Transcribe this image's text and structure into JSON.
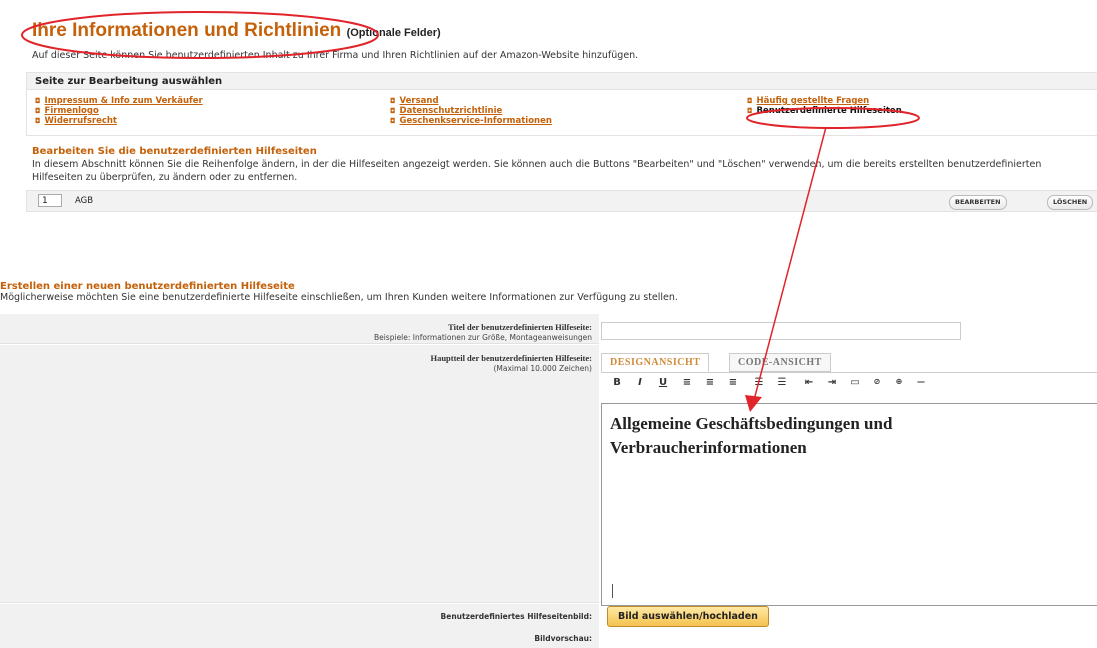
{
  "header": {
    "title": "Ihre Informationen und Richtlinien",
    "optional": "(Optionale Felder)",
    "intro": "Auf dieser Seite können Sie benutzerdefinierten Inhalt zu Ihrer Firma und Ihren Richtlinien auf der Amazon-Website hinzufügen."
  },
  "selector": {
    "heading": "Seite zur Bearbeitung auswählen",
    "col1": [
      "Impressum & Info zum Verkäufer",
      "Firmenlogo",
      "Widerrufsrecht"
    ],
    "col2": [
      "Versand",
      "Datenschutzrichtlinie",
      "Geschenkservice-Informationen"
    ],
    "col3": [
      "Häufig gestellte Fragen",
      "Benutzerdefinierte Hilfeseiten"
    ]
  },
  "edit": {
    "heading": "Bearbeiten Sie die benutzerdefinierten Hilfeseiten",
    "text": "In diesem Abschnitt können Sie die Reihenfolge ändern, in der die Hilfeseiten angezeigt werden. Sie können auch die Buttons \"Bearbeiten\" und \"Löschen\" verwenden, um die bereits erstellten benutzerdefinierten Hilfeseiten zu überprüfen, zu ändern oder zu entfernen.",
    "row": {
      "order": "1",
      "name": "AGB",
      "edit_btn": "BEARBEITEN",
      "delete_btn": "LÖSCHEN"
    }
  },
  "create": {
    "heading": "Erstellen einer neuen benutzerdefinierten Hilfeseite",
    "text": "Möglicherweise möchten Sie eine benutzerdefinierte Hilfeseite einschließen, um Ihren Kunden weitere Informationen zur Verfügung zu stellen.",
    "title_label": "Titel der benutzerdefinierten Hilfeseite:",
    "title_example": "Beispiele: Informationen zur Größe, Montageanweisungen",
    "body_label": "Hauptteil der benutzerdefinierten Hilfeseite:",
    "body_max": "(Maximal 10.000 Zeichen)",
    "tab_design": "DESIGNANSICHT",
    "tab_code": "CODE-ANSICHT",
    "toolbar": [
      "B",
      "I",
      "U",
      "≡",
      "≡",
      "≡",
      "☰",
      "☰",
      "⇤",
      "⇥",
      "▭",
      "⊘",
      "⊕",
      "—"
    ],
    "editor_line1": "Allgemeine Geschäftsbedingungen und",
    "editor_line2": "Verbraucherinformationen",
    "image_label": "Benutzerdefiniertes Hilfeseitenbild:",
    "image_btn": "Bild auswählen/hochladen",
    "preview_label": "Bildvorschau:"
  },
  "colors": {
    "accent": "#c4610a",
    "annotation": "#e0242a"
  }
}
